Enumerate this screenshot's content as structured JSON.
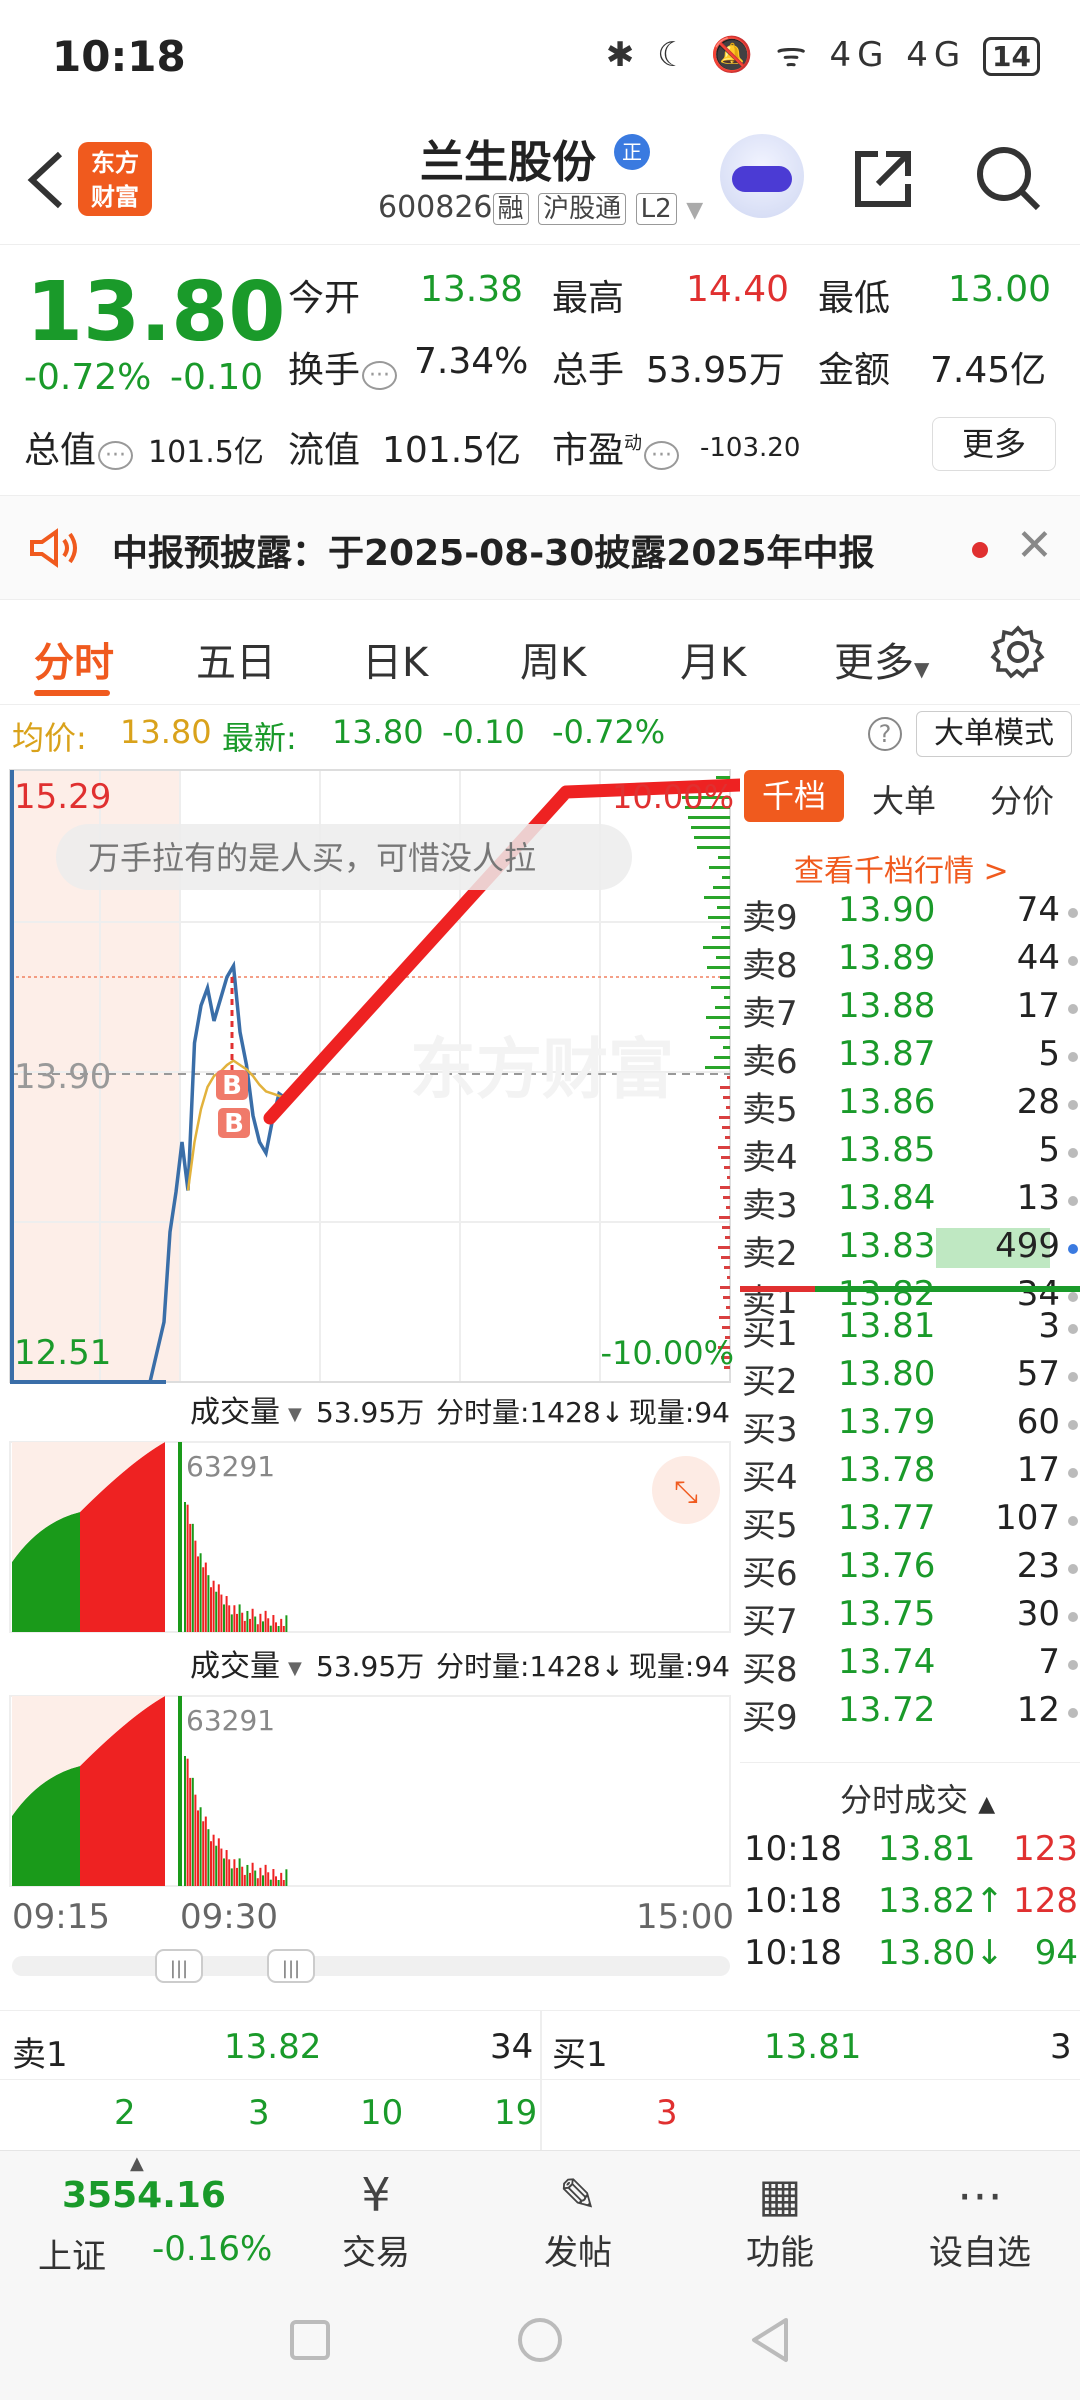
{
  "status": {
    "time": "10:18",
    "icons": "✱ ☾ 🔕 ᯤ 4G 4G",
    "battery": "14"
  },
  "header": {
    "app_logo": "东方\n财富",
    "stock_name": "兰生股份",
    "badge": "正",
    "code": "600826",
    "tags": [
      "融",
      "沪股通",
      "L2"
    ]
  },
  "quote": {
    "price": "13.80",
    "change_pct": "-0.72%",
    "change": "-0.10",
    "open_label": "今开",
    "open": "13.38",
    "high_label": "最高",
    "high": "14.40",
    "low_label": "最低",
    "low": "13.00",
    "turnover_label": "换手",
    "turnover": "7.34%",
    "volume_label": "总手",
    "volume": "53.95万",
    "amount_label": "金额",
    "amount": "7.45亿",
    "mktcap_label": "总值",
    "mktcap": "101.5亿",
    "float_label": "流值",
    "float": "101.5亿",
    "pe_label": "市盈",
    "pe_sup": "动",
    "pe": "-103.20",
    "more": "更多"
  },
  "notice": {
    "text": "中报预披露：于2025-08-30披露2025年中报"
  },
  "tabs": [
    "分时",
    "五日",
    "日K",
    "周K",
    "月K",
    "更多"
  ],
  "avgbar": {
    "avg_label": "均价:",
    "avg": "13.80",
    "last_label": "最新:",
    "last": "13.80",
    "chg": "-0.10",
    "pct": "-0.72%",
    "mode": "大单模式"
  },
  "chart": {
    "top_price": "15.29",
    "bottom_price": "12.51",
    "mid_price": "13.90",
    "top_pct": "10.00%",
    "bottom_pct": "-10.00%",
    "comment": "万手拉有的是人买，可惜没人拉",
    "marker": "B",
    "watermark": "东方财富",
    "vol_label": "成交量",
    "vol_total": "53.95万",
    "vol_min_label": "分时量:1428↓",
    "vol_now_label": "现量:94",
    "vol_peak": "63291",
    "time_start": "09:15",
    "time_mid": "09:30",
    "time_end": "15:00"
  },
  "chart_data": {
    "type": "line",
    "x": [
      "09:30",
      "09:31",
      "09:32",
      "09:33",
      "09:34",
      "09:35",
      "09:36",
      "09:37",
      "09:38",
      "09:39",
      "09:40",
      "09:41",
      "09:42",
      "09:43",
      "09:44",
      "09:45"
    ],
    "series": [
      {
        "values": [
          13.38,
          14.05,
          14.22,
          14.3,
          14.15,
          14.25,
          14.35,
          14.4,
          14.1,
          13.95,
          13.72,
          13.6,
          13.55,
          13.7,
          13.82,
          13.8
        ]
      },
      {
        "values": [
          13.38,
          13.6,
          13.75,
          13.85,
          13.9,
          13.92,
          13.95,
          13.97,
          13.95,
          13.93,
          13.9,
          13.86,
          13.83,
          13.82,
          13.81,
          13.8
        ]
      }
    ],
    "ylim": [
      12.51,
      15.29
    ]
  },
  "orderbook": {
    "tabs": [
      "千档",
      "大单",
      "分价"
    ],
    "link": "查看千档行情 >",
    "sells": [
      {
        "label": "卖9",
        "price": "13.90",
        "qty": "74"
      },
      {
        "label": "卖8",
        "price": "13.89",
        "qty": "44"
      },
      {
        "label": "卖7",
        "price": "13.88",
        "qty": "17"
      },
      {
        "label": "卖6",
        "price": "13.87",
        "qty": "5"
      },
      {
        "label": "卖5",
        "price": "13.86",
        "qty": "28"
      },
      {
        "label": "卖4",
        "price": "13.85",
        "qty": "5"
      },
      {
        "label": "卖3",
        "price": "13.84",
        "qty": "13"
      },
      {
        "label": "卖2",
        "price": "13.83",
        "qty": "499"
      },
      {
        "label": "卖1",
        "price": "13.82",
        "qty": "34"
      }
    ],
    "buys": [
      {
        "label": "买1",
        "price": "13.81",
        "qty": "3"
      },
      {
        "label": "买2",
        "price": "13.80",
        "qty": "57"
      },
      {
        "label": "买3",
        "price": "13.79",
        "qty": "60"
      },
      {
        "label": "买4",
        "price": "13.78",
        "qty": "17"
      },
      {
        "label": "买5",
        "price": "13.77",
        "qty": "107"
      },
      {
        "label": "买6",
        "price": "13.76",
        "qty": "23"
      },
      {
        "label": "买7",
        "price": "13.75",
        "qty": "30"
      },
      {
        "label": "买8",
        "price": "13.74",
        "qty": "7"
      },
      {
        "label": "买9",
        "price": "13.72",
        "qty": "12"
      }
    ],
    "ticks_title": "分时成交",
    "ticks": [
      {
        "time": "10:18",
        "price": "13.81",
        "vol": "123"
      },
      {
        "time": "10:18",
        "price": "13.82↑",
        "vol": "128"
      },
      {
        "time": "10:18",
        "price": "13.80↓",
        "vol": "94"
      }
    ]
  },
  "bottomquote": {
    "sell_label": "卖1",
    "sell_price": "13.82",
    "sell_qty": "34",
    "buy_label": "买1",
    "buy_price": "13.81",
    "buy_qty": "3",
    "sell_queue": [
      "2",
      "3",
      "10",
      "19"
    ],
    "buy_queue": [
      "3"
    ]
  },
  "navbar": {
    "index_value": "3554.16",
    "index_name": "上证",
    "index_chg": "-0.16%",
    "items": [
      {
        "label": "交易",
        "icon": "¥"
      },
      {
        "label": "发帖",
        "icon": "✎"
      },
      {
        "label": "功能",
        "icon": "▦"
      },
      {
        "label": "设自选",
        "icon": "⋯"
      }
    ]
  }
}
